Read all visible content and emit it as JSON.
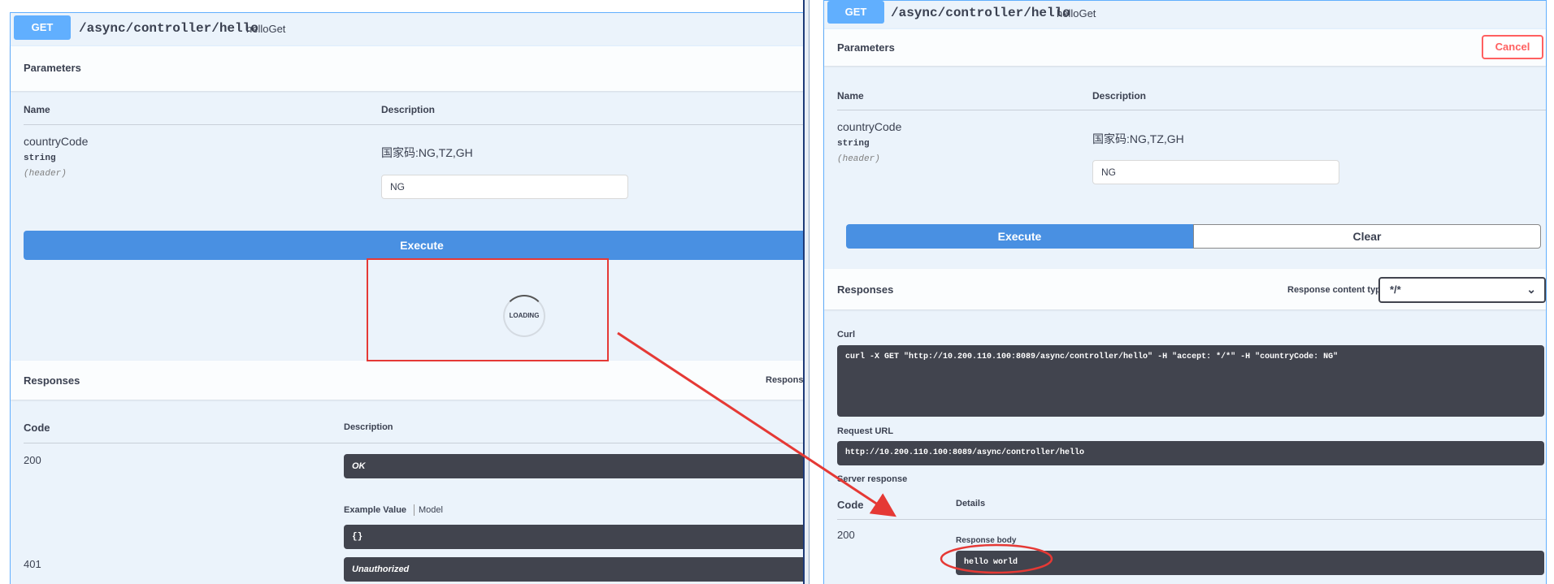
{
  "left": {
    "method": "GET",
    "path": "/async/controller/hello",
    "operation_id": "helloGet",
    "parameters_title": "Parameters",
    "col_name": "Name",
    "col_description": "Description",
    "param_name": "countryCode",
    "param_type": "string",
    "param_in": "(header)",
    "param_desc": "国家码:NG,TZ,GH",
    "param_value": "NG",
    "execute_label": "Execute",
    "loading_label": "LOADING",
    "responses_title": "Responses",
    "response_ct_label": "Response",
    "code_col": "Code",
    "desc_col": "Description",
    "responses": [
      {
        "code": "200",
        "description": "OK"
      },
      {
        "code": "401",
        "description": "Unauthorized"
      }
    ],
    "example_value_tab": "Example Value",
    "model_tab": "Model",
    "example_body": "{}"
  },
  "right": {
    "method": "GET",
    "path": "/async/controller/hello",
    "operation_id": "helloGet",
    "parameters_title": "Parameters",
    "cancel_label": "Cancel",
    "col_name": "Name",
    "col_description": "Description",
    "param_name": "countryCode",
    "param_type": "string",
    "param_in": "(header)",
    "param_desc": "国家码:NG,TZ,GH",
    "param_value": "NG",
    "execute_label": "Execute",
    "clear_label": "Clear",
    "responses_title": "Responses",
    "response_ct_label": "Response content type",
    "response_ct_value": "*/*",
    "curl_label": "Curl",
    "curl_command": "curl -X GET \"http://10.200.110.100:8089/async/controller/hello\" -H \"accept: */*\" -H \"countryCode: NG\"",
    "request_url_label": "Request URL",
    "request_url": "http://10.200.110.100:8089/async/controller/hello",
    "server_response_label": "Server response",
    "code_col": "Code",
    "details_col": "Details",
    "response_code": "200",
    "response_body_label": "Response body",
    "response_body": "hello world"
  },
  "colors": {
    "get_blue": "#61affe",
    "execute_blue": "#4990e2",
    "annotation_red": "#e53935",
    "dark_code_bg": "#41444e"
  }
}
